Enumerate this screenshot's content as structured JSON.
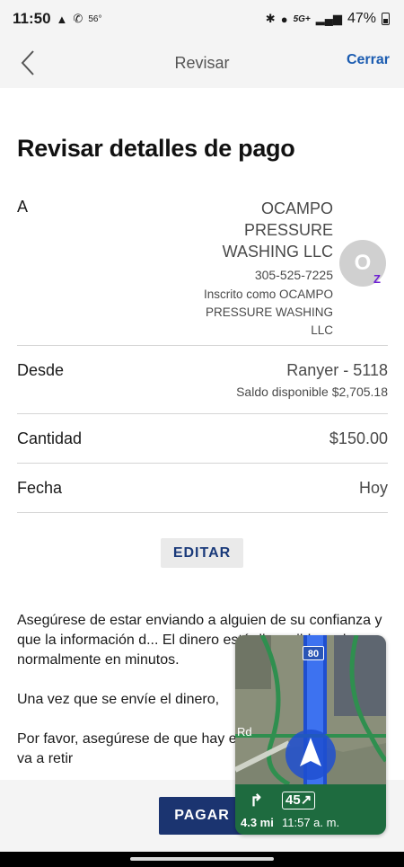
{
  "status_bar": {
    "time": "11:50",
    "temperature": "56°",
    "network": "5G+",
    "battery": "47%"
  },
  "header": {
    "title": "Revisar",
    "close_label": "Cerrar"
  },
  "main": {
    "title": "Revisar detalles de pago",
    "to": {
      "label": "A",
      "name_lines": [
        "OCAMPO",
        "PRESSURE",
        "WASHING LLC"
      ],
      "phone": "305-525-7225",
      "enrolled_lines": [
        "Inscrito como OCAMPO",
        "PRESSURE WASHING",
        "LLC"
      ],
      "avatar_letter": "O",
      "badge": "Z"
    },
    "from": {
      "label": "Desde",
      "account": "Ranyer - 5118",
      "balance": "Saldo disponible $2,705.18"
    },
    "amount": {
      "label": "Cantidad",
      "value": "$150.00"
    },
    "date": {
      "label": "Fecha",
      "value": "Hoy"
    },
    "edit_label": "EDITAR",
    "disclaimer": {
      "p1": "Asegúrese de estar enviando a alguien de su confianza y que la información d... El dinero está disponible en la c... normalmente en minutos.",
      "p2": "Una vez que se envíe el dinero,",
      "p3": "Por favor, asegúrese de que hay en la cuenta de la que va a retir"
    }
  },
  "footer": {
    "pay_label": "PAGAR"
  },
  "map_overlay": {
    "highway": "80",
    "road_label": "Rd",
    "distance": "4.3 mi",
    "speed": "45",
    "eta": "11:57 a. m."
  },
  "colors": {
    "accent": "#1a5bb0",
    "pay_button": "#1b3470",
    "zelle": "#6d1ed4",
    "nav_green": "#1e6b3f"
  }
}
